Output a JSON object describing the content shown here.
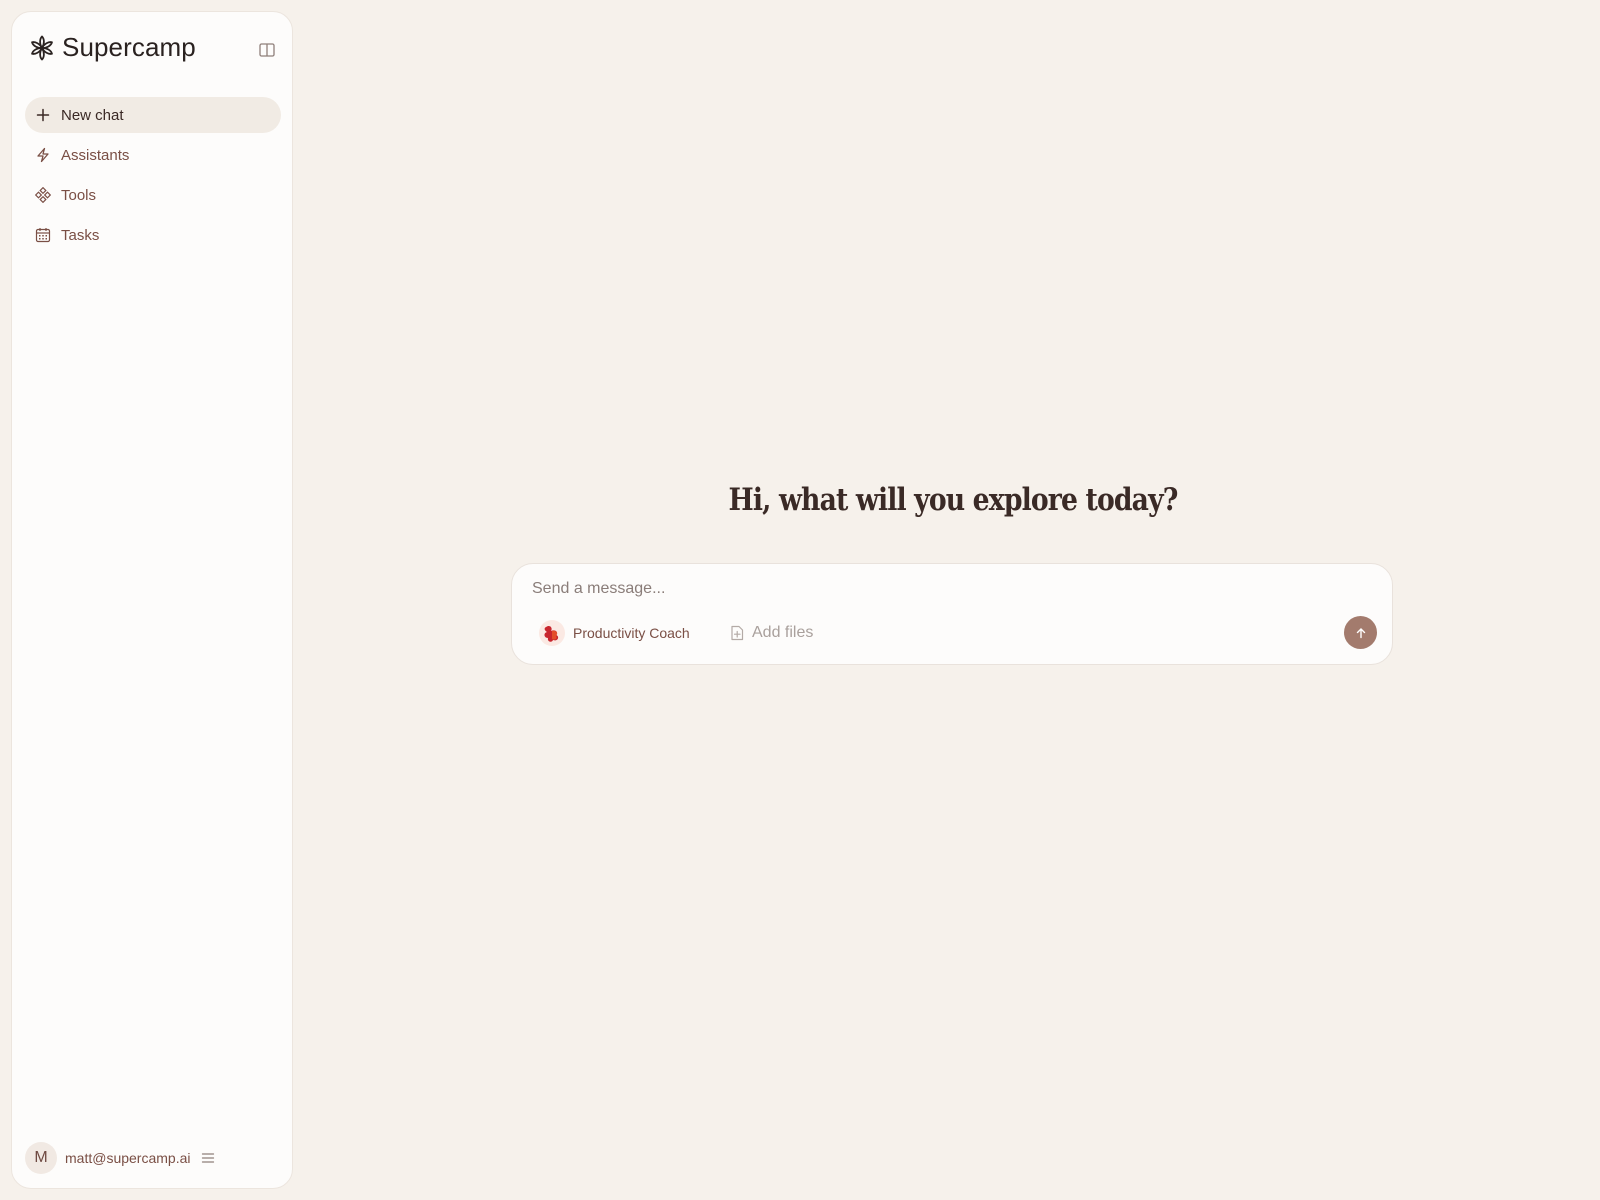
{
  "sidebar": {
    "brand": "Supercamp",
    "items": [
      {
        "label": "New chat",
        "icon": "plus-icon",
        "active": true
      },
      {
        "label": "Assistants",
        "icon": "lightning-icon"
      },
      {
        "label": "Tools",
        "icon": "tools-icon"
      },
      {
        "label": "Tasks",
        "icon": "calendar-icon"
      }
    ],
    "user": {
      "initial": "M",
      "email": "matt@supercamp.ai"
    }
  },
  "main": {
    "greeting": "Hi, what will you explore today?",
    "composer": {
      "placeholder": "Send a message...",
      "assistant": "Productivity Coach",
      "add_files": "Add files"
    }
  },
  "colors": {
    "background": "#f6f1eb",
    "sidebar": "#fdfcfb",
    "accent": "#a37b6d",
    "nav_text": "#7a4f45"
  }
}
